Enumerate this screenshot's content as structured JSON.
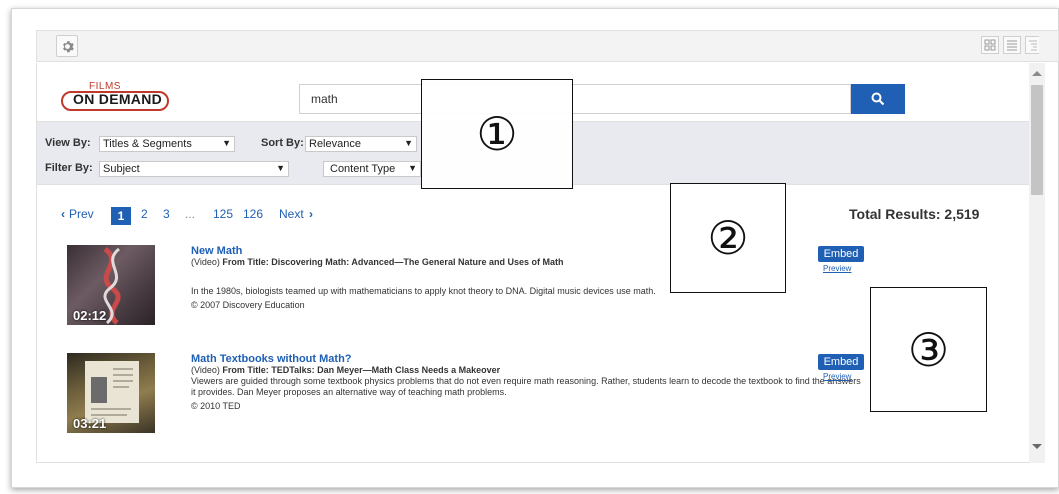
{
  "toolbar": {
    "settings_icon": "gear-icon",
    "view_icons": [
      "grid-view-icon",
      "list-view-icon",
      "tree-view-icon"
    ]
  },
  "header": {
    "logo_top": "FILMS",
    "logo_bottom": "ON DEMAND",
    "search_value": "math",
    "search_icon": "search-icon"
  },
  "filters": {
    "view_by_label": "View By:",
    "view_by_value": "Titles & Segments",
    "sort_by_label": "Sort By:",
    "sort_by_value": "Relevance",
    "filter_by_label": "Filter By:",
    "filter_by_value": "Subject",
    "content_type_value": "Content Type",
    "dropdown_arrow": "▼"
  },
  "pagination": {
    "prev": "Prev",
    "prev_chevron": "‹",
    "pages": [
      "1",
      "2",
      "3",
      "...",
      "125",
      "126"
    ],
    "next": "Next",
    "next_chevron": "›"
  },
  "total_results": "Total Results: 2,519",
  "results": [
    {
      "duration": "02:12",
      "title": "New Math",
      "type": "(Video)",
      "from_label": "From Title:",
      "from_title": "Discovering Math: Advanced—The General Nature and Uses of Math",
      "description": "In the 1980s, biologists teamed up with mathematicians to apply knot theory to DNA. Digital music devices use math.",
      "copyright": "© 2007 Discovery Education",
      "embed": "Embed",
      "preview": "Preview"
    },
    {
      "duration": "03:21",
      "title": "Math Textbooks without Math?",
      "type": "(Video)",
      "from_label": "From Title:",
      "from_title": "TEDTalks: Dan Meyer—Math Class Needs a Makeover",
      "description": "Viewers are guided through some textbook physics problems that do not even require math reasoning. Rather, students learn to decode the textbook to find the answers it provides. Dan Meyer proposes an alternative way of teaching math problems.",
      "copyright": "© 2010 TED",
      "embed": "Embed",
      "preview": "Preview"
    }
  ],
  "callouts": [
    "①",
    "②",
    "③"
  ],
  "colors": {
    "accent": "#1f5fb4",
    "logo_red": "#c0392b",
    "filter_bar": "#e9eaf0"
  }
}
